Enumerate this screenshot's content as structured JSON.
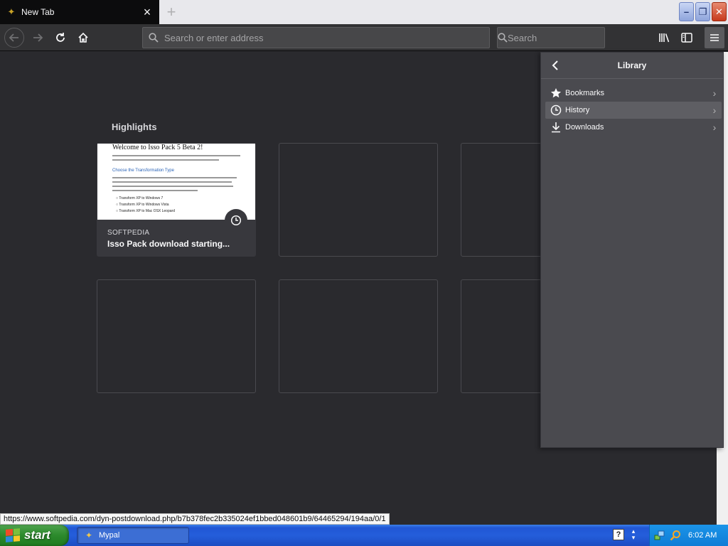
{
  "tab": {
    "title": "New Tab",
    "favicon": "mypal-icon",
    "close_label": "×"
  },
  "newtab": {
    "label": "+"
  },
  "window_controls": {
    "minimize": "–",
    "maximize": "❐",
    "close": "✕"
  },
  "navbar": {
    "url_placeholder": "Search or enter address",
    "search_placeholder": "Search"
  },
  "content": {
    "highlights_title": "Highlights",
    "cards": [
      {
        "host": "SOFTPEDIA",
        "title": "Isso Pack download starting...",
        "thumb": {
          "heading": "Welcome to Isso Pack 5 Beta 2!",
          "subheading": "Choose the Transformation Type",
          "options": [
            "Transform XP to Windows 7",
            "Transform XP to Windows Vista",
            "Transform XP to Mac OSX Leopard"
          ]
        }
      }
    ]
  },
  "panel": {
    "title": "Library",
    "items": [
      {
        "label": "Bookmarks",
        "icon": "star-icon"
      },
      {
        "label": "History",
        "icon": "clock-icon"
      },
      {
        "label": "Downloads",
        "icon": "download-icon"
      }
    ]
  },
  "status_url": "https://www.softpedia.com/dyn-postdownload.php/b7b378fec2b335024ef1bbed048601b9/64465294/194aa/0/1",
  "taskbar": {
    "start_label": "start",
    "task_label": "Mypal",
    "help_label": "?",
    "clock": "6:02 AM"
  },
  "colors": {
    "toolbar": "#323234",
    "content": "#2a2a2e",
    "panel": "#4a4a4f",
    "taskbar": "#245edb"
  }
}
